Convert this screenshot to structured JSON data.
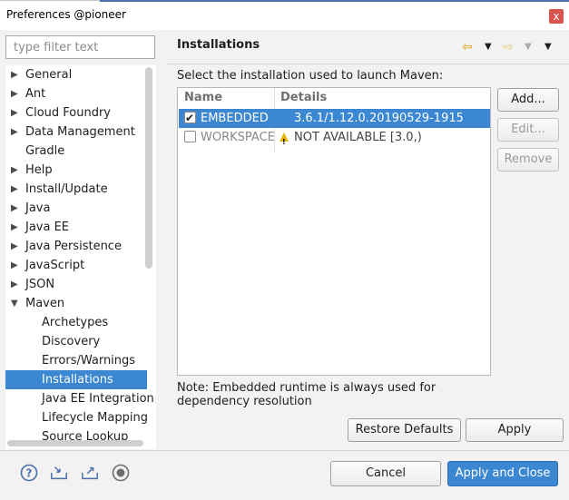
{
  "window": {
    "title": "Preferences @pioneer",
    "close_label": "x"
  },
  "filter": {
    "placeholder": "type filter text"
  },
  "tree": {
    "items": [
      {
        "label": "General",
        "expander": "▶"
      },
      {
        "label": "Ant",
        "expander": "▶"
      },
      {
        "label": "Cloud Foundry",
        "expander": "▶"
      },
      {
        "label": "Data Management",
        "expander": "▶"
      },
      {
        "label": "Gradle",
        "expander": ""
      },
      {
        "label": "Help",
        "expander": "▶"
      },
      {
        "label": "Install/Update",
        "expander": "▶"
      },
      {
        "label": "Java",
        "expander": "▶"
      },
      {
        "label": "Java EE",
        "expander": "▶"
      },
      {
        "label": "Java Persistence",
        "expander": "▶"
      },
      {
        "label": "JavaScript",
        "expander": "▶"
      },
      {
        "label": "JSON",
        "expander": "▶"
      },
      {
        "label": "Maven",
        "expander": "▼"
      }
    ],
    "maven_children": [
      "Archetypes",
      "Discovery",
      "Errors/Warnings",
      "Installations",
      "Java EE Integration",
      "Lifecycle Mapping",
      "Source Lookup"
    ],
    "selected": "Installations"
  },
  "page": {
    "heading": "Installations",
    "description": "Select the installation used to launch Maven:",
    "columns": [
      "Name",
      "Details"
    ],
    "rows": [
      {
        "name": "EMBEDDED",
        "details": "3.6.1/1.12.0.20190529-1915",
        "checked": true
      },
      {
        "name": "WORKSPACE",
        "details": "NOT AVAILABLE [3.0,)",
        "checked": false
      }
    ],
    "note": "Note: Embedded runtime is always used for dependency resolution",
    "buttons": {
      "add": "Add...",
      "edit": "Edit...",
      "remove": "Remove",
      "restore": "Restore Defaults",
      "apply": "Apply"
    }
  },
  "footer": {
    "cancel": "Cancel",
    "apply_close": "Apply and Close"
  },
  "colors": {
    "selection": "#3b87d2",
    "accent": "#4a6ea9",
    "warning": "#e8b400"
  }
}
